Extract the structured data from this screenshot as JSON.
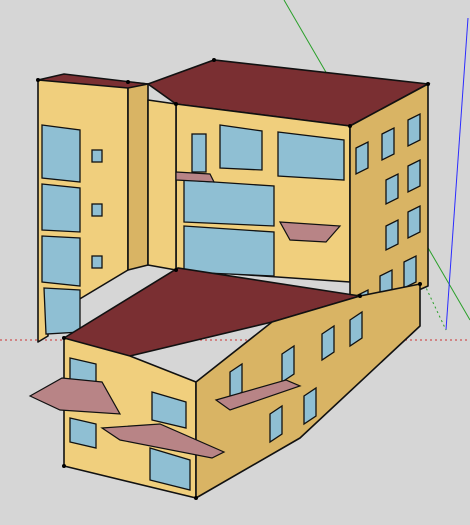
{
  "viewport": {
    "background": "#d6d6d6",
    "tool": "3d-modeling-viewport"
  },
  "axes": {
    "green": "#2aa02a",
    "blue": "#2b2bff",
    "red": "#cc3333"
  },
  "model": {
    "wall_front": "#f0cf7d",
    "wall_side": "#d9b464",
    "roof": "#7a2f32",
    "glass": "#8fbfd3",
    "balcony": "#b88486"
  }
}
